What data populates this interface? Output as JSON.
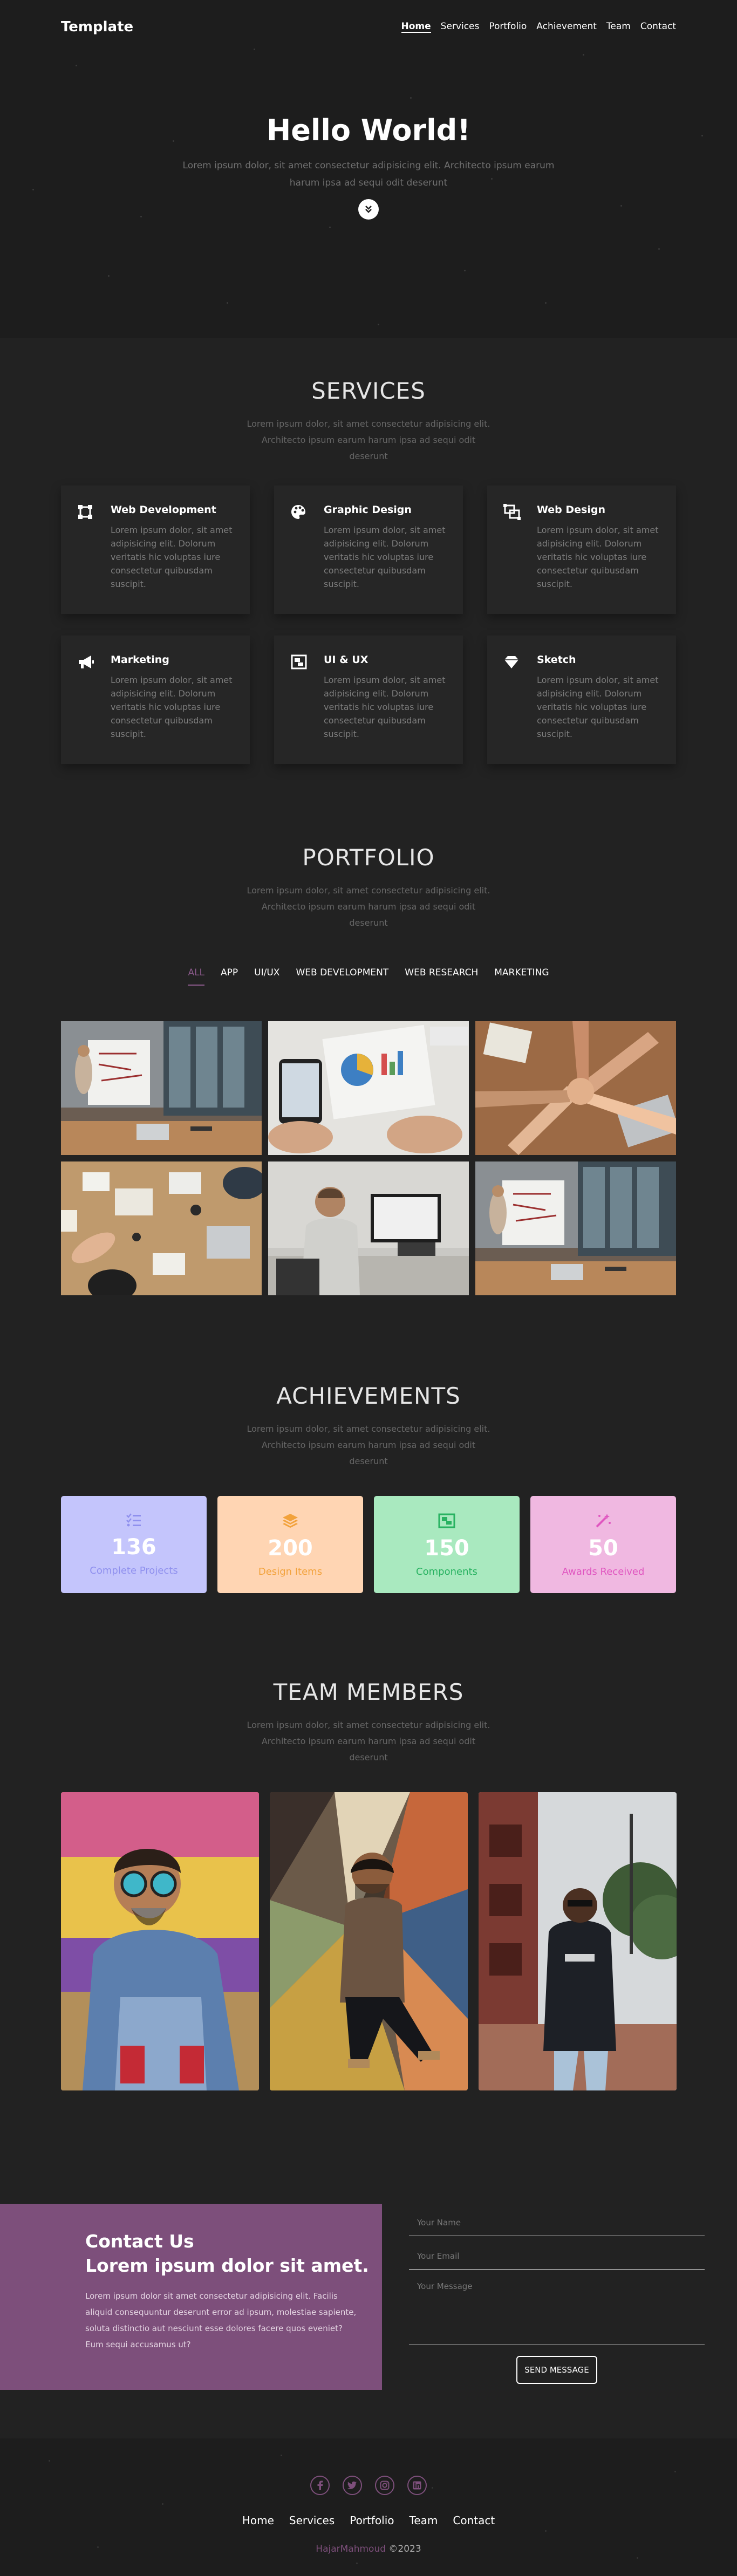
{
  "nav": {
    "brand": "Template",
    "items": [
      "Home",
      "Services",
      "Portfolio",
      "Achievement",
      "Team",
      "Contact"
    ],
    "active": "Home"
  },
  "hero": {
    "title": "Hello World!",
    "subtitle": "Lorem ipsum dolor, sit amet consectetur adipisicing elit. Architecto ipsum earum harum ipsa ad sequi odit deserunt",
    "scroll_icon": "double-chevron-down-icon"
  },
  "services": {
    "title": "SERVICES",
    "subtitle": "Lorem ipsum dolor, sit amet consectetur adipisicing elit. Architecto ipsum earum harum ipsa ad sequi odit deserunt",
    "cards": [
      {
        "title": "Web Development",
        "text": "Lorem ipsum dolor, sit amet adipisicing elit. Dolorum veritatis hic voluptas iure consectetur quibusdam suscipit.",
        "icon": "vector-square-icon"
      },
      {
        "title": "Graphic Design",
        "text": "Lorem ipsum dolor, sit amet adipisicing elit. Dolorum veritatis hic voluptas iure consectetur quibusdam suscipit.",
        "icon": "palette-icon"
      },
      {
        "title": "Web Design",
        "text": "Lorem ipsum dolor, sit amet adipisicing elit. Dolorum veritatis hic voluptas iure consectetur quibusdam suscipit.",
        "icon": "object-ungroup-icon"
      },
      {
        "title": "Marketing",
        "text": "Lorem ipsum dolor, sit amet adipisicing elit. Dolorum veritatis hic voluptas iure consectetur quibusdam suscipit.",
        "icon": "bullhorn-icon"
      },
      {
        "title": "UI & UX",
        "text": "Lorem ipsum dolor, sit amet adipisicing elit. Dolorum veritatis hic voluptas iure consectetur quibusdam suscipit.",
        "icon": "object-group-icon"
      },
      {
        "title": "Sketch",
        "text": "Lorem ipsum dolor, sit amet adipisicing elit. Dolorum veritatis hic voluptas iure consectetur quibusdam suscipit.",
        "icon": "gem-icon"
      }
    ]
  },
  "portfolio": {
    "title": "PORTFOLIO",
    "subtitle": "Lorem ipsum dolor, sit amet consectetur adipisicing elit. Architecto ipsum earum harum ipsa ad sequi odit deserunt",
    "filters": [
      "ALL",
      "APP",
      "UI/UX",
      "WEB DEVELOPMENT",
      "WEB RESEARCH",
      "MARKETING"
    ],
    "active_filter": "ALL",
    "images": [
      "whiteboard-presentation",
      "charts-on-desk",
      "team-hands-together",
      "team-meeting-overhead",
      "man-at-computer",
      "whiteboard-presentation"
    ]
  },
  "achievements": {
    "title": "ACHIEVEMENTS",
    "subtitle": "Lorem ipsum dolor, sit amet consectetur adipisicing elit. Architecto ipsum earum harum ipsa ad sequi odit deserunt",
    "items": [
      {
        "value": "136",
        "label": "Complete Projects",
        "icon": "tasks-icon",
        "bg": "#c4c5fc",
        "accent": "#8f90ee"
      },
      {
        "value": "200",
        "label": "Design Items",
        "icon": "layer-group-icon",
        "bg": "#ffd5b3",
        "accent": "#f2a23c"
      },
      {
        "value": "150",
        "label": "Components",
        "icon": "object-ungroup-icon",
        "bg": "#a9e9bf",
        "accent": "#28b261"
      },
      {
        "value": "50",
        "label": "Awards Received",
        "icon": "magic-wand-icon",
        "bg": "#f0b8e1",
        "accent": "#e056c0"
      }
    ]
  },
  "team": {
    "title": "TEAM MEMBERS",
    "subtitle": "Lorem ipsum dolor, sit amet consectetur adipisicing elit. Architecto ipsum earum harum ipsa ad sequi odit deserunt",
    "members": [
      "man-with-sunglasses-denim",
      "man-sitting-graffiti",
      "man-black-hoodie-street"
    ]
  },
  "contact": {
    "title": "Contact Us",
    "heading": "Lorem ipsum dolor sit amet.",
    "text": "Lorem ipsum dolor sit amet consectetur adipisicing elit. Facilis aliquid consequuntur deserunt error ad ipsum, molestiae sapiente, soluta distinctio aut nesciunt esse dolores facere quos eveniet? Eum sequi accusamus ut?",
    "name_placeholder": "Your Name",
    "email_placeholder": "Your Email",
    "message_placeholder": "Your Message",
    "send_label": "SEND MESSAGE"
  },
  "footer": {
    "social": [
      "facebook-icon",
      "twitter-icon",
      "instagram-icon",
      "linkedin-icon"
    ],
    "menu": [
      "Home",
      "Services",
      "Portfolio",
      "Team",
      "Contact"
    ],
    "author": "HajarMahmoud",
    "year": "©2023"
  },
  "colors": {
    "background": "#222222",
    "hero_bg": "#1d1d1d",
    "accent_purple": "#7d4f7b"
  }
}
